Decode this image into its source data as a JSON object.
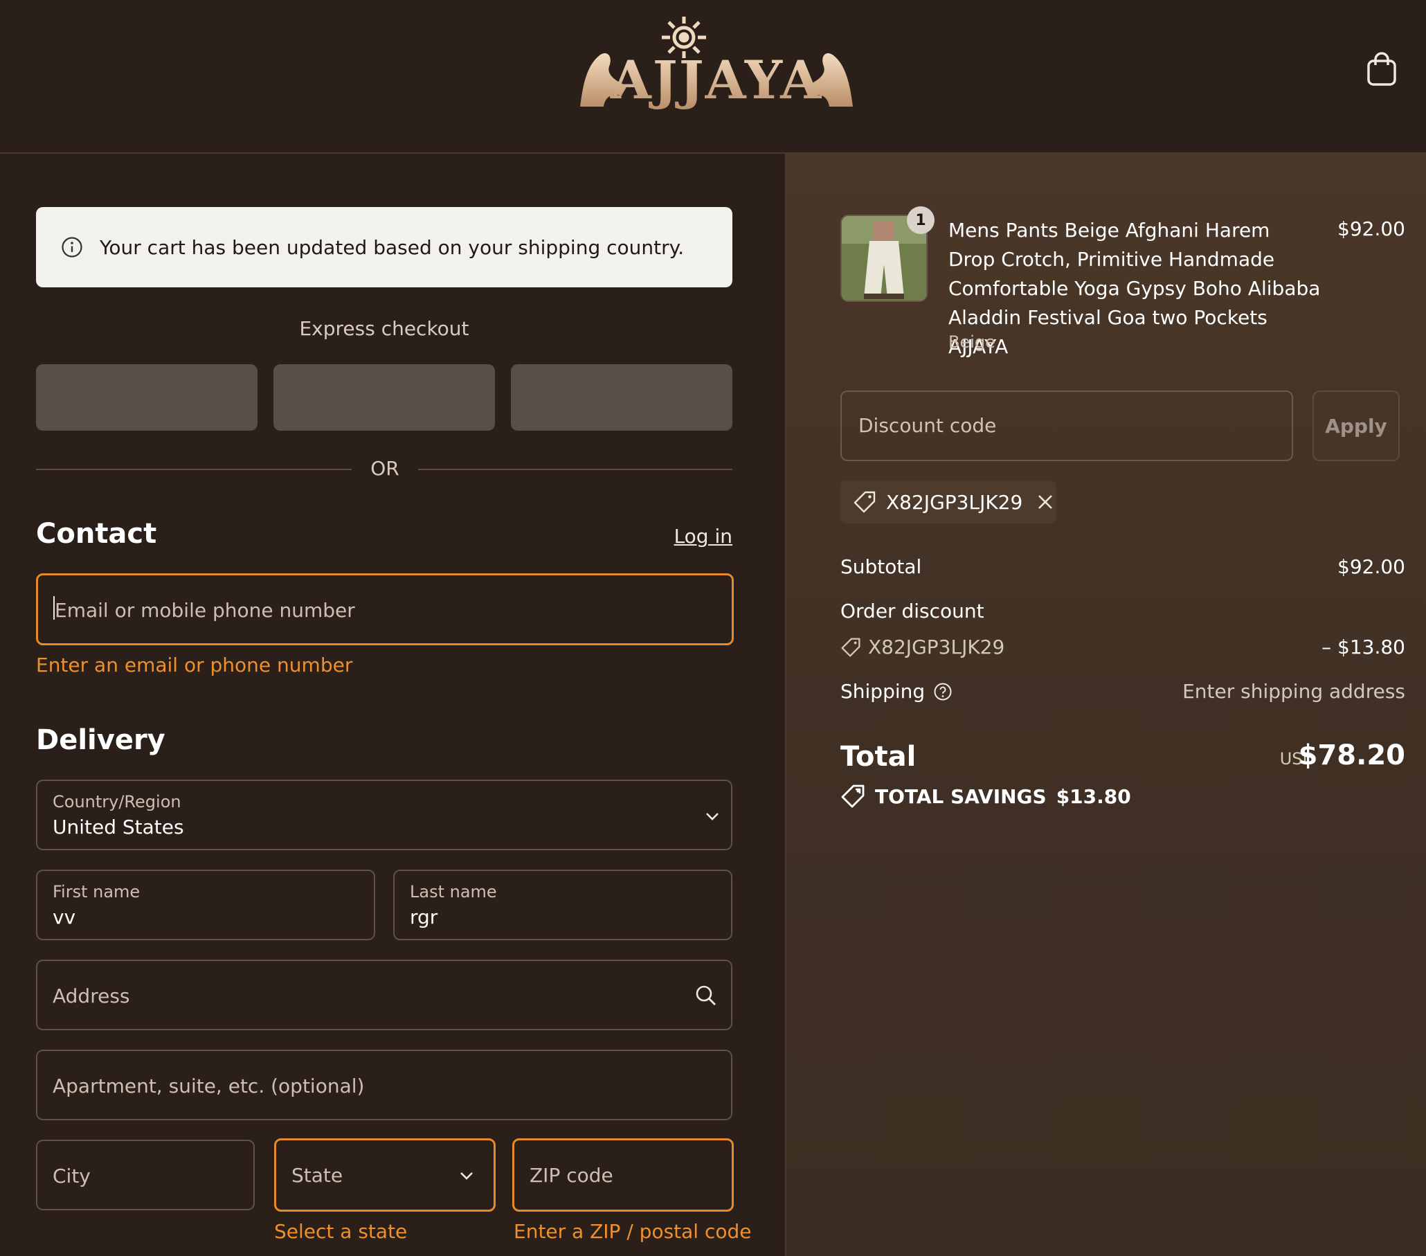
{
  "header": {
    "brand": "AJJAYA",
    "cart_icon": "shopping-bag-icon"
  },
  "notice": {
    "text": "Your cart has been updated based on your shipping country.",
    "icon": "info-icon"
  },
  "express": {
    "label": "Express checkout",
    "or": "OR"
  },
  "contact": {
    "title": "Contact",
    "login": "Log in",
    "email_placeholder": "Email or mobile phone number",
    "email_error": "Enter an email or phone number"
  },
  "delivery": {
    "title": "Delivery",
    "country_label": "Country/Region",
    "country_value": "United States",
    "first_name_label": "First name",
    "first_name_value": "vv",
    "last_name_label": "Last name",
    "last_name_value": "rgr",
    "address_placeholder": "Address",
    "apartment_placeholder": "Apartment, suite, etc. (optional)",
    "city_placeholder": "City",
    "state_placeholder": "State",
    "state_error": "Select a state",
    "zip_placeholder": "ZIP code",
    "zip_error": "Enter a ZIP / postal code"
  },
  "summary": {
    "product": {
      "quantity": "1",
      "title": "Mens Pants Beige Afghani Harem Drop Crotch, Primitive Handmade Comfortable Yoga Gypsy Boho Alibaba Aladdin Festival Goa two Pockets AJJAYA",
      "variant": "Beige",
      "price": "$92.00"
    },
    "discount_placeholder": "Discount code",
    "apply_label": "Apply",
    "applied_code": "X82JGP3LJK29",
    "subtotal_label": "Subtotal",
    "subtotal_value": "$92.00",
    "order_discount_label": "Order discount",
    "order_discount_code": "X82JGP3LJK29",
    "order_discount_value": "– $13.80",
    "shipping_label": "Shipping",
    "shipping_value": "Enter shipping address",
    "total_label": "Total",
    "total_currency": "USD",
    "total_value": "$78.20",
    "savings_label": "TOTAL SAVINGS",
    "savings_value": "$13.80"
  },
  "colors": {
    "accent_error": "#e88a2c",
    "background": "#2a2019",
    "summary_bg": "#45342a"
  }
}
